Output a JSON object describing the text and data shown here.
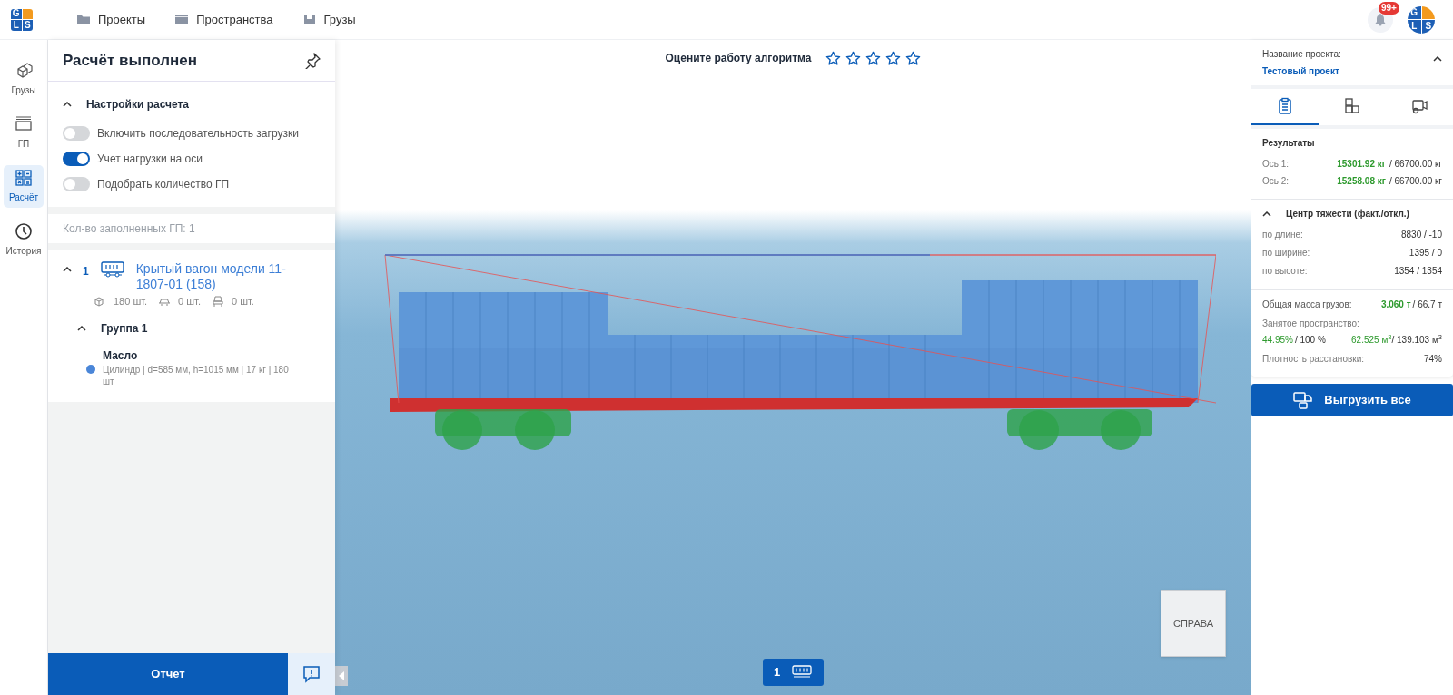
{
  "top_nav": {
    "logo_letters": [
      "G",
      "L",
      "S"
    ],
    "items": [
      {
        "label": "Проекты",
        "kind": "folder"
      },
      {
        "label": "Пространства",
        "kind": "container"
      },
      {
        "label": "Грузы",
        "kind": "box"
      }
    ],
    "notifications_badge": "99+",
    "avatar_letters": [
      "G",
      "L",
      "S"
    ]
  },
  "side_rail": [
    {
      "label": "Грузы",
      "kind": "cubes",
      "selected": false
    },
    {
      "label": "ГП",
      "kind": "container",
      "selected": false
    },
    {
      "label": "Расчёт",
      "kind": "calc",
      "selected": true
    },
    {
      "label": "История",
      "kind": "clock",
      "selected": false
    }
  ],
  "panel": {
    "title": "Расчёт выполнен",
    "settings": {
      "title": "Настройки расчета",
      "expanded": true,
      "toggles": [
        {
          "label": "Включить последовательность загрузки",
          "on": false
        },
        {
          "label": "Учет нагрузки на оси",
          "on": true
        },
        {
          "label": "Подобрать количество ГП",
          "on": false
        }
      ]
    },
    "filled_count": "Кол-во заполненных ГП: 1",
    "vehicles": [
      {
        "index": "1",
        "name": "Крытый вагон модели 11-1807-01 (158)",
        "expanded": true,
        "counts": [
          "180 шт.",
          "0 шт.",
          "0 шт."
        ],
        "groups": [
          {
            "title": "Группа 1",
            "expanded": true,
            "items": [
              {
                "name": "Масло",
                "details": "Цилиндр | d=585 мм, h=1015 мм | 17 кг | 180 шт",
                "color": "#4a86d8"
              }
            ]
          }
        ]
      }
    ],
    "report_button": "Отчет"
  },
  "rating": {
    "label": "Оцените работу алгоритма",
    "stars": 0
  },
  "view_cube": {
    "label": "СПРАВА"
  },
  "bottom_tabs": [
    {
      "label": "1",
      "selected": true
    }
  ],
  "project": {
    "label": "Название проекта:",
    "name": "Тестовый проект",
    "expanded": true
  },
  "right_tabs": [
    {
      "kind": "clipboard",
      "selected": true
    },
    {
      "kind": "cubes",
      "selected": false
    },
    {
      "kind": "vehicle",
      "selected": false
    }
  ],
  "results": {
    "title": "Результаты",
    "axles": [
      {
        "label": "Ось 1:",
        "value": "15301.92 кг",
        "limit": "/ 66700.00 кг"
      },
      {
        "label": "Ось 2:",
        "value": "15258.08 кг",
        "limit": "/ 66700.00 кг"
      }
    ]
  },
  "gravity": {
    "title": "Центр тяжести (факт./откл.)",
    "expanded": true,
    "rows": [
      {
        "label": "по длине:",
        "value": "8830 / -10"
      },
      {
        "label": "по ширине:",
        "value": "1395 / 0"
      },
      {
        "label": "по высоте:",
        "value": "1354 / 1354"
      }
    ]
  },
  "summary": {
    "mass_label": "Общая масса грузов:",
    "mass_value": "3.060 т",
    "mass_limit": "/ 66.7 т",
    "space_label": "Занятое пространство:",
    "space_percent": "44.95%",
    "space_percent_limit": "/ 100 %",
    "space_volume": "62.525 м$^{3}$",
    "space_volume_limit": "/ 139.103 м$^{3}$",
    "density_label": "Плотность расстановки:",
    "density_value": "74%"
  },
  "unload_button": "Выгрузить все"
}
